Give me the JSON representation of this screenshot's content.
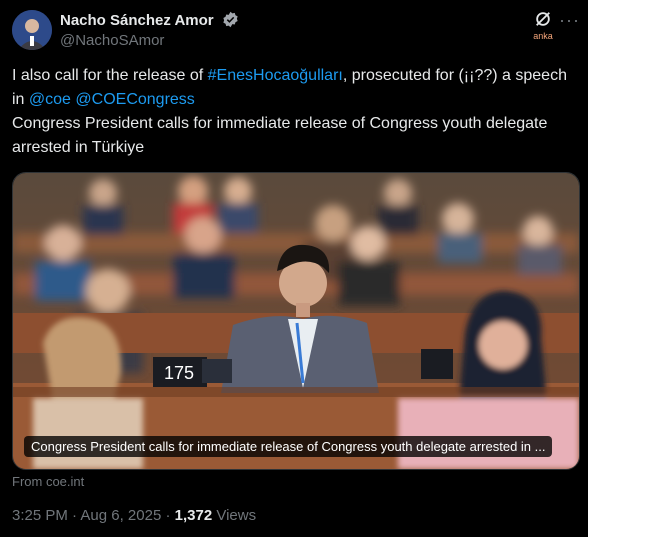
{
  "author": {
    "name": "Nacho Sánchez Amor",
    "handle": "@NachoSAmor",
    "verified_icon": "verified-badge-icon"
  },
  "grok": {
    "label": "anka",
    "icon": "grok-icon"
  },
  "more_icon": "more-icon",
  "tweet": {
    "part1": "I also call for the release of ",
    "hashtag": "#EnesHocaoğulları",
    "part2": ", prosecuted for (¡¡??) a speech in ",
    "mention1": "@coe",
    "space": " ",
    "mention2": "@COECongress",
    "line2": "Congress President calls for immediate release of Congress youth delegate arrested in Türkiye"
  },
  "card": {
    "caption": "Congress President calls for immediate release of Congress youth delegate arrested in ...",
    "nameplate": "175",
    "source": "From coe.int"
  },
  "meta": {
    "time": "3:25 PM",
    "sep1": " · ",
    "date": "Aug 6, 2025",
    "sep2": " · ",
    "views_count": "1,372",
    "views_label": " Views"
  },
  "colors": {
    "link": "#1d9bf0",
    "background": "#000000",
    "muted": "#71767b"
  }
}
